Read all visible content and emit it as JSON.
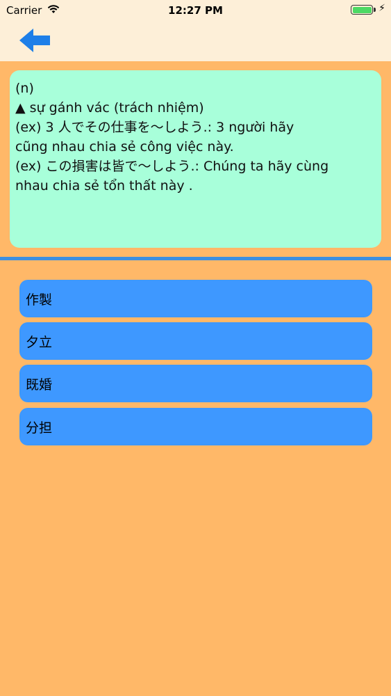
{
  "status_bar": {
    "carrier": "Carrier",
    "time": "12:27 PM",
    "wifi_icon": "wifi-icon",
    "battery_icon": "battery-icon",
    "charging_icon": "bolt-icon"
  },
  "navbar": {
    "back_icon": "arrow-left-icon",
    "back_color": "#1E7FE8"
  },
  "meaning": {
    "lines": [
      "(n)",
      "▲ sự gánh vác (trách nhiệm)",
      "(ex) 3 人でその仕事を～しよう.: 3 người hãy",
      "cũng nhau chia sẻ công việc này.",
      "(ex) この損害は皆で～しよう.: Chúng ta hãy cùng",
      "nhau chia sẻ tổn thất này ."
    ],
    "background": "#A8FFDA"
  },
  "choices": [
    {
      "label": "作製"
    },
    {
      "label": "夕立"
    },
    {
      "label": "既婚"
    },
    {
      "label": "分担"
    }
  ],
  "colors": {
    "background": "#FFB868",
    "header": "#FDEFD8",
    "choice_button": "#3E98FF",
    "divider": "#3D8FE0"
  }
}
